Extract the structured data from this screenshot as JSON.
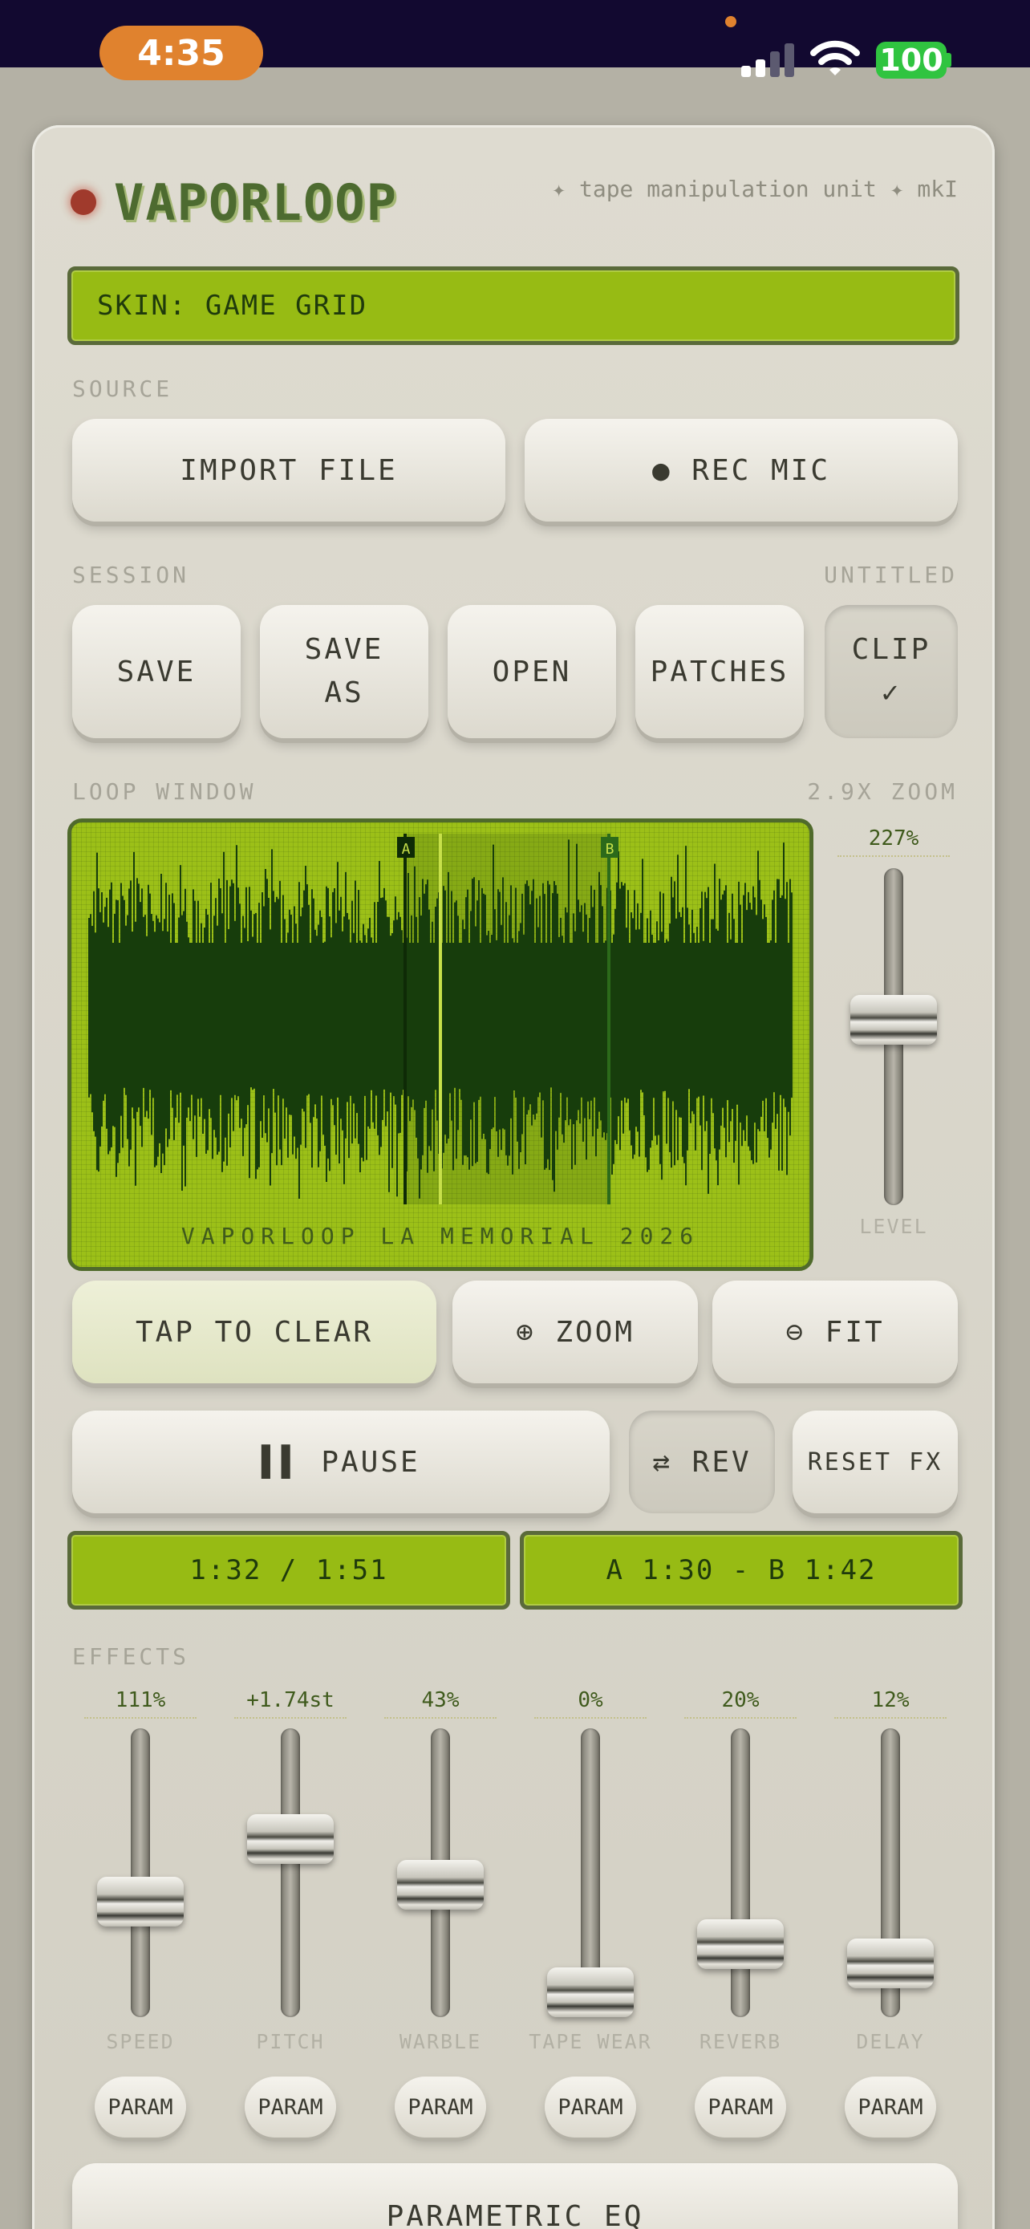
{
  "status": {
    "time": "4:35",
    "battery": "100"
  },
  "app": {
    "name": "VAPORLOOP",
    "tagline": "✦ tape manipulation unit ✦ mkI"
  },
  "skin": {
    "label": "SKIN: GAME GRID"
  },
  "source": {
    "label": "SOURCE",
    "import_label": "IMPORT FILE",
    "rec_label": "● REC MIC"
  },
  "session": {
    "label": "SESSION",
    "name": "UNTITLED",
    "save_label": "SAVE",
    "save_as_line1": "SAVE",
    "save_as_line2": "AS",
    "open_label": "OPEN",
    "patches_label": "PATCHES",
    "clip_line1": "CLIP",
    "clip_line2": "✓"
  },
  "loop_window": {
    "label": "LOOP WINDOW",
    "zoom": "2.9X ZOOM",
    "caption": "VAPORLOOP LA MEMORIAL 2026",
    "marker_a": "A",
    "marker_b": "B",
    "level_value": "227%",
    "level_label": "LEVEL",
    "level_fraction": 0.56
  },
  "controls": {
    "clear_label": "TAP TO CLEAR",
    "zoom_label": "⊕ ZOOM",
    "fit_label": "⊖ FIT",
    "pause_label": "▌▌ PAUSE",
    "rev_label": "⇄ REV",
    "reset_label": "RESET FX"
  },
  "readouts": {
    "position": "1:32 / 1:51",
    "loop": "A 1:30 - B 1:42"
  },
  "effects": {
    "label": "EFFECTS",
    "param_label": "PARAM",
    "sliders": [
      {
        "name": "SPEED",
        "value": "111%",
        "fraction": 0.38
      },
      {
        "name": "PITCH",
        "value": "+1.74st",
        "fraction": 0.64
      },
      {
        "name": "WARBLE",
        "value": "43%",
        "fraction": 0.45
      },
      {
        "name": "TAPE WEAR",
        "value": "0%",
        "fraction": 0.0
      },
      {
        "name": "REVERB",
        "value": "20%",
        "fraction": 0.2
      },
      {
        "name": "DELAY",
        "value": "12%",
        "fraction": 0.12
      }
    ]
  },
  "eq": {
    "label": "PARAMETRIC EQ"
  }
}
